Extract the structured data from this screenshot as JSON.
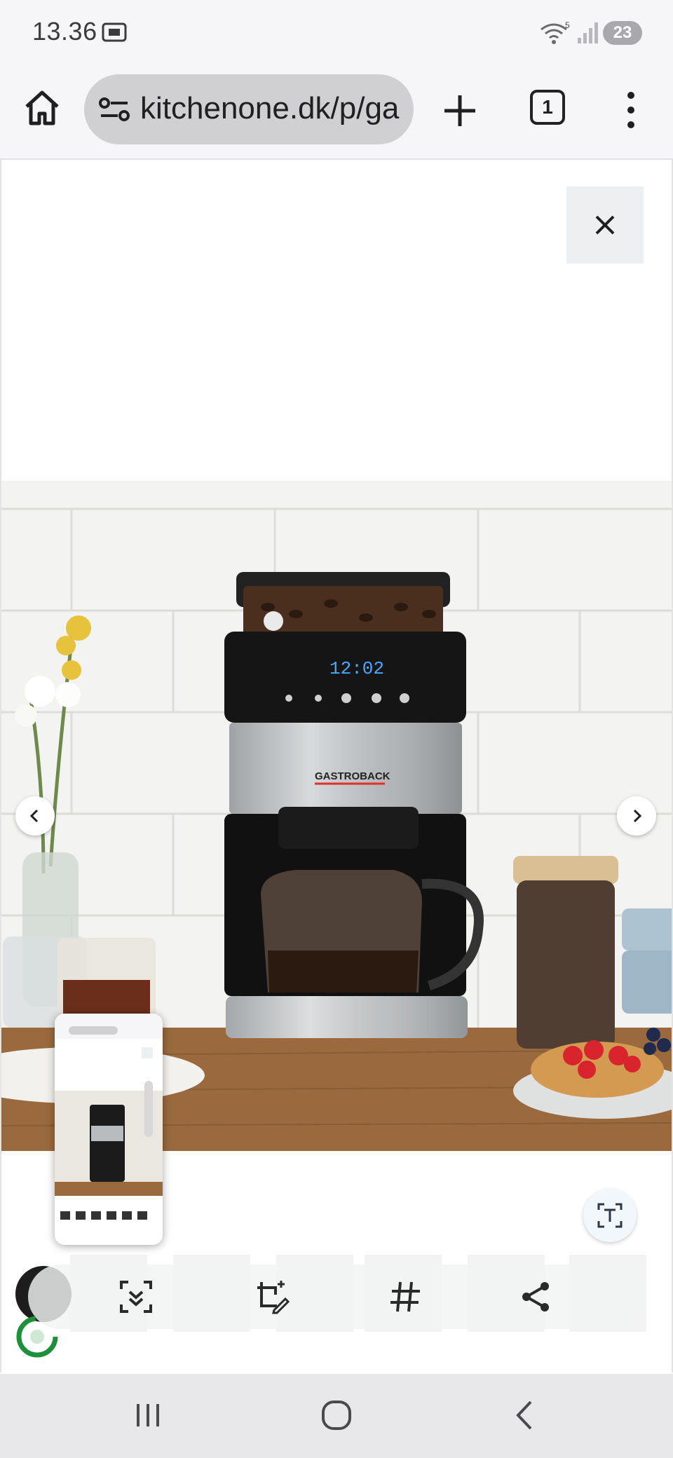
{
  "status_bar": {
    "time": "13.36",
    "wifi_badge": "5",
    "battery": "23",
    "icons": [
      "screen-recorder-icon",
      "wifi-icon",
      "signal-icon"
    ]
  },
  "browser": {
    "url": "kitchenone.dk/p/ga",
    "tab_count": "1",
    "icons": [
      "home-icon",
      "site-settings-icon",
      "plus-icon",
      "more-vert-icon"
    ]
  },
  "gallery": {
    "brand_label": "GASTROBACK",
    "display_time": "12:02",
    "thumbnail_count": 6,
    "icons": [
      "close-icon",
      "chevron-left-icon",
      "chevron-right-icon"
    ]
  },
  "capture_toolbar": {
    "icons": [
      "expand-capture-icon",
      "crop-edit-icon",
      "hashtag-icon",
      "share-icon",
      "text-extract-icon"
    ]
  },
  "nav_bar": {
    "icons": [
      "recents-icon",
      "home-circle-icon",
      "back-icon"
    ]
  },
  "colors": {
    "status_bg": "#f6f6f9",
    "urlbar_bg": "#d0d0d2",
    "navbar_bg": "#e8e8eb",
    "accent_red": "#e0302a",
    "display_blue": "#4aa8ff"
  }
}
